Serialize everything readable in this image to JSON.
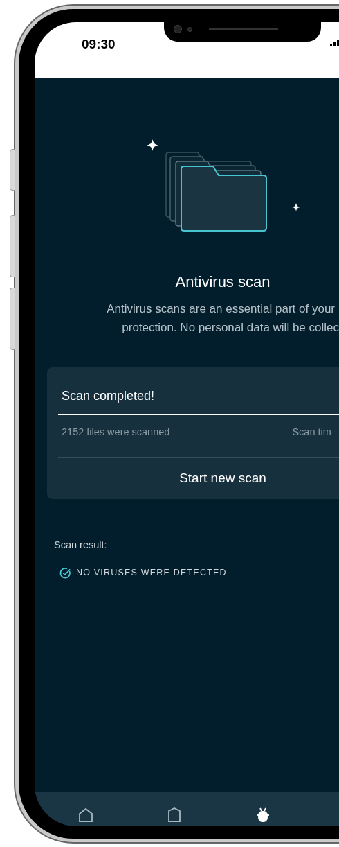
{
  "status_bar": {
    "time": "09:30"
  },
  "title": "Antivirus scan",
  "description_lines": [
    "Antivirus scans are an essential part of your",
    "protection. No personal data will be collec"
  ],
  "scan_card": {
    "status": "Scan completed!",
    "progress": {
      "level": 1
    },
    "files_scanned": "2152 files were scanned",
    "scan_time": "Scan tim",
    "button": "Start new scan"
  },
  "result": {
    "label": "Scan result:",
    "message": "NO VIRUSES WERE DETECTED"
  },
  "nav": [
    {
      "kind": "home",
      "selected": false
    },
    {
      "kind": "shield",
      "selected": false
    },
    {
      "kind": "bug",
      "selected": true
    }
  ]
}
